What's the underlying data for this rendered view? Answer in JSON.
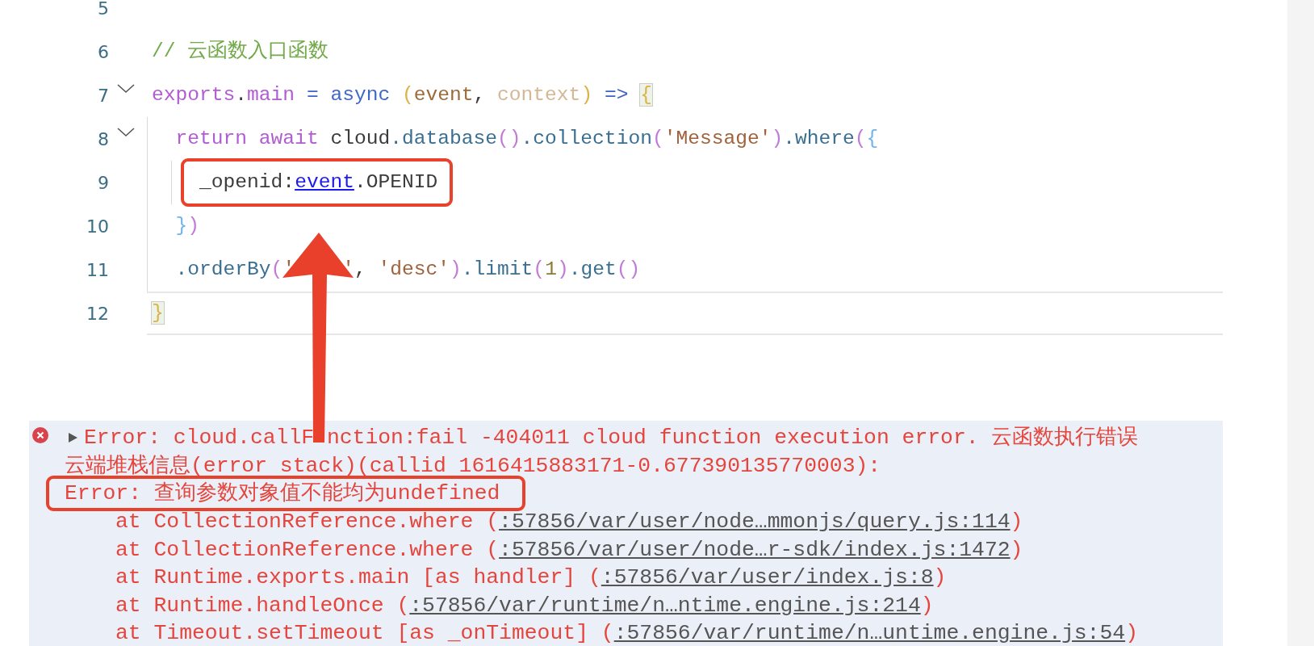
{
  "editor": {
    "lines": [
      {
        "number": "5",
        "foldable": false,
        "current": false,
        "boxed": false
      },
      {
        "number": "6",
        "foldable": false,
        "current": false,
        "boxed": false,
        "tokens": [
          {
            "kind": "comment",
            "text": "// 云函数入口函数"
          }
        ]
      },
      {
        "number": "7",
        "foldable": true,
        "current": false,
        "boxed": false,
        "tokens": [
          {
            "kind": "keyword",
            "text": "exports"
          },
          {
            "kind": "plain",
            "text": "."
          },
          {
            "kind": "keyword",
            "text": "main"
          },
          {
            "kind": "op",
            "text": " = "
          },
          {
            "kind": "storage",
            "text": "async"
          },
          {
            "kind": "paren_y",
            "text": " ("
          },
          {
            "kind": "param",
            "text": "event"
          },
          {
            "kind": "plain",
            "text": ", "
          },
          {
            "kind": "param_dim",
            "text": "context"
          },
          {
            "kind": "paren_y",
            "text": ")"
          },
          {
            "kind": "op",
            "text": " => "
          },
          {
            "kind": "brace_match",
            "text": "{"
          }
        ]
      },
      {
        "number": "8",
        "foldable": true,
        "current": false,
        "boxed": false,
        "tokens": [
          {
            "kind": "keyword",
            "text": "  return await"
          },
          {
            "kind": "plain",
            "text": " cloud"
          },
          {
            "kind": "prop",
            "text": ".database"
          },
          {
            "kind": "paren_p",
            "text": "()"
          },
          {
            "kind": "prop",
            "text": ".collection"
          },
          {
            "kind": "paren_p",
            "text": "("
          },
          {
            "kind": "string",
            "text": "'Message'"
          },
          {
            "kind": "paren_p",
            "text": ")"
          },
          {
            "kind": "prop",
            "text": ".where"
          },
          {
            "kind": "paren_p",
            "text": "("
          },
          {
            "kind": "paren_b",
            "text": "{"
          }
        ]
      },
      {
        "number": "9",
        "foldable": false,
        "current": false,
        "boxed": true,
        "tokens": [
          {
            "kind": "plain",
            "text": "    _openid:"
          },
          {
            "kind": "link",
            "text": "event"
          },
          {
            "kind": "plain",
            "text": ".OPENID"
          }
        ]
      },
      {
        "number": "10",
        "foldable": false,
        "current": false,
        "boxed": false,
        "tokens": [
          {
            "kind": "paren_b",
            "text": "  }"
          },
          {
            "kind": "paren_p",
            "text": ")"
          }
        ]
      },
      {
        "number": "11",
        "foldable": false,
        "current": false,
        "boxed": false,
        "tokens": [
          {
            "kind": "prop",
            "text": "  .orderBy"
          },
          {
            "kind": "paren_p",
            "text": "("
          },
          {
            "kind": "string",
            "text": "'"
          },
          {
            "kind": "covered"
          },
          {
            "kind": "string",
            "text": "'"
          },
          {
            "kind": "plain",
            "text": ", "
          },
          {
            "kind": "string",
            "text": "'desc'"
          },
          {
            "kind": "paren_p",
            "text": ")"
          },
          {
            "kind": "prop",
            "text": ".limit"
          },
          {
            "kind": "paren_p",
            "text": "("
          },
          {
            "kind": "number",
            "text": "1"
          },
          {
            "kind": "paren_p",
            "text": ")"
          },
          {
            "kind": "prop",
            "text": ".get"
          },
          {
            "kind": "paren_p",
            "text": "()"
          }
        ]
      },
      {
        "number": "12",
        "foldable": false,
        "current": true,
        "boxed": false,
        "tokens": [
          {
            "kind": "brace_match",
            "text": "}"
          }
        ]
      }
    ]
  },
  "console": {
    "entries": [
      {
        "kind": "error",
        "expanded": false,
        "message": [
          {
            "text": "Error: cloud.callF"
          },
          {
            "kind": "covered"
          },
          {
            "text": "nction:fail -404011 cloud function execution error. 云函数执行错误"
          }
        ],
        "details": [
          {
            "text": "云端堆栈信息(error stack)(callid 1616415883171-0.677390135770003):",
            "boxed": false
          },
          {
            "text": "Error: 查询参数对象值不能均为undefined",
            "boxed": true
          }
        ],
        "stack": [
          {
            "call": "at CollectionReference.where (",
            "source": ":57856/var/user/node…mmonjs/query.js:114",
            "end": ")"
          },
          {
            "call": "at CollectionReference.where (",
            "source": ":57856/var/user/node…r-sdk/index.js:1472",
            "end": ")"
          },
          {
            "call": "at Runtime.exports.main [as handler] (",
            "source": ":57856/var/user/index.js:8",
            "end": ")"
          },
          {
            "call": "at Runtime.handleOnce (",
            "source": ":57856/var/runtime/n…ntime.engine.js:214",
            "end": ")"
          },
          {
            "call": "at Timeout.setTimeout [as _onTimeout] (",
            "source": ":57856/var/runtime/n…untime.engine.js:54",
            "end": ")"
          }
        ]
      }
    ]
  },
  "annotations": [
    {
      "kind": "arrow"
    }
  ]
}
